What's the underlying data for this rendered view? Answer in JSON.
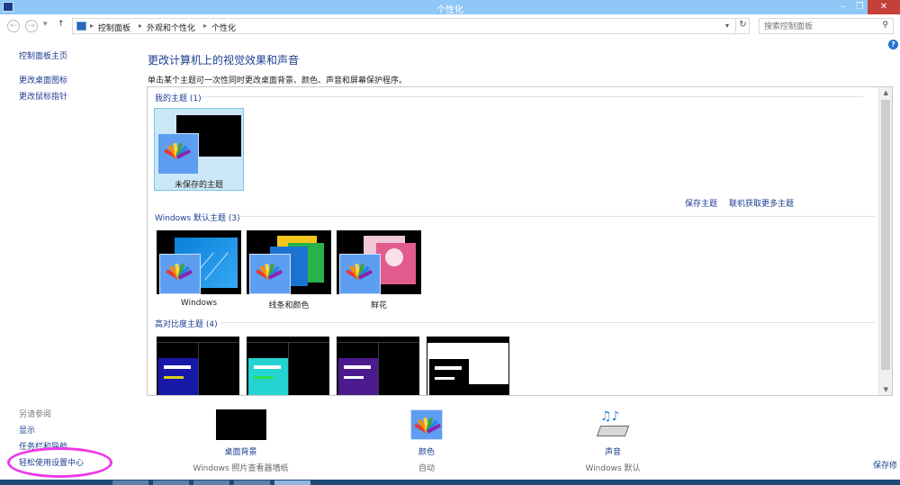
{
  "window": {
    "title": "个性化"
  },
  "controls": {
    "minimize": "–",
    "maximize": "❐",
    "close": "✕"
  },
  "nav": {
    "back": "←",
    "forward": "→",
    "dropdown": "▾",
    "up": "↑",
    "breadcrumb": [
      "控制面板",
      "外观和个性化",
      "个性化"
    ],
    "separator": "▸",
    "refresh": "↻",
    "search_placeholder": "搜索控制面板"
  },
  "help": "?",
  "sidebar": {
    "links": [
      "控制面板主页",
      "更改桌面图标",
      "更改鼠标指针"
    ],
    "see_also_heading": "另请参阅",
    "see_also_links": [
      "显示",
      "任务栏和导航",
      "轻松使用设置中心"
    ]
  },
  "main": {
    "title": "更改计算机上的视觉效果和声音",
    "description": "单击某个主题可一次性同时更改桌面背景、颜色、声音和屏幕保护程序。"
  },
  "themes": {
    "my_themes_title": "我的主题 (1)",
    "my_themes": [
      {
        "label": "未保存的主题"
      }
    ],
    "save_theme_link": "保存主题",
    "get_more_link": "联机获取更多主题",
    "windows_title": "Windows 默认主题 (3)",
    "windows_themes": [
      {
        "label": "Windows"
      },
      {
        "label": "线条和颜色"
      },
      {
        "label": "鲜花"
      }
    ],
    "high_contrast_title": "高对比度主题 (4)",
    "high_contrast_count": 4
  },
  "bottom": {
    "desktop_bg_label": "桌面背景",
    "desktop_bg_sub": "Windows 照片查看器墙纸",
    "color_label": "颜色",
    "color_sub": "自动",
    "sound_label": "声音",
    "sound_sub": "Windows 默认",
    "save_link": "保存修"
  },
  "colors": {
    "titlebar": "#8fc7f6",
    "link": "#1a3d8f",
    "selection": "#cce8f7",
    "highlight_ring": "#ee37e8",
    "taskbar": "#1f4a78"
  }
}
